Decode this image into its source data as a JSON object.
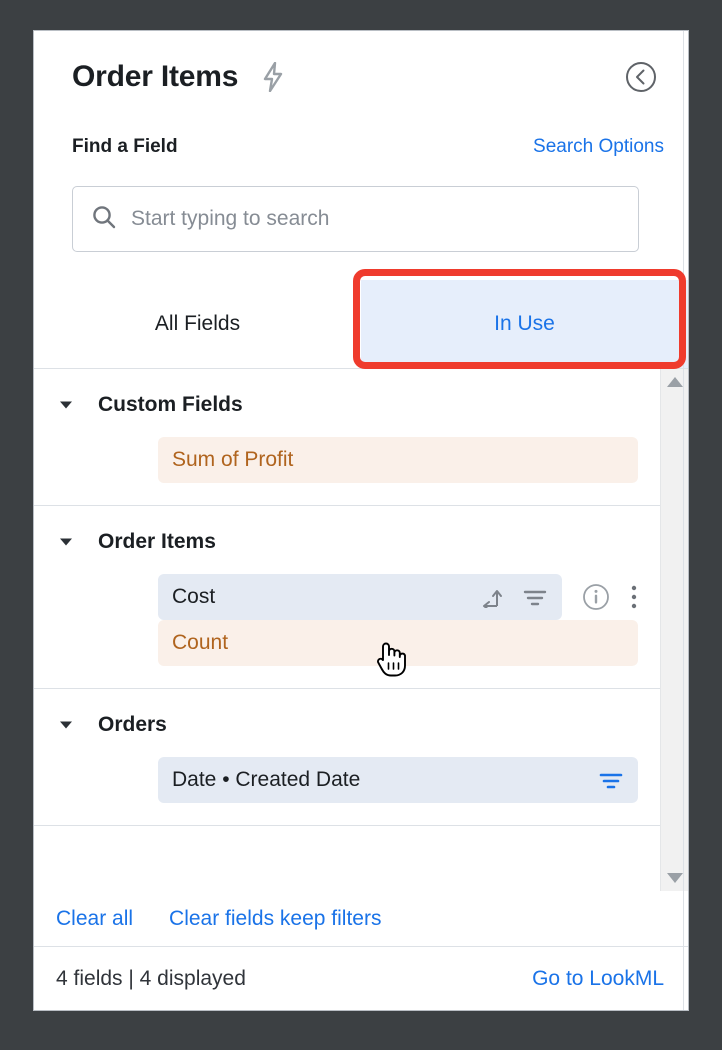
{
  "window": {
    "backdrop_color": "#3c4043",
    "panel_border_color": "#b9bec4"
  },
  "header": {
    "title": "Order Items",
    "bolt_icon": "lightning-bolt-icon",
    "collapse_icon": "chevron-left-circle-icon"
  },
  "find": {
    "label": "Find a Field",
    "search_options_label": "Search Options"
  },
  "search": {
    "icon": "search-icon",
    "value": "",
    "placeholder": "Start typing to search"
  },
  "tabs": [
    {
      "label": "All Fields",
      "active": false
    },
    {
      "label": "In Use",
      "active": true
    }
  ],
  "highlight": {
    "target": "In Use",
    "color": "#ef3b2d"
  },
  "sections": [
    {
      "title": "Custom Fields",
      "expanded": true,
      "fields": [
        {
          "label": "Sum of Profit",
          "kind": "measure",
          "icons": []
        }
      ]
    },
    {
      "title": "Order Items",
      "expanded": true,
      "fields": [
        {
          "label": "Cost",
          "kind": "dimension",
          "icons": [
            "pivot-icon",
            "filter-icon"
          ],
          "row_icons": [
            "info-icon",
            "overflow-menu-icon"
          ],
          "hovered": true
        },
        {
          "label": "Count",
          "kind": "measure",
          "icons": []
        }
      ]
    },
    {
      "title": "Orders",
      "expanded": true,
      "fields": [
        {
          "label": "Date • Created Date",
          "kind": "dimension",
          "icons": [
            "filter-icon-active"
          ]
        }
      ]
    }
  ],
  "clear_bar": {
    "clear_all_label": "Clear all",
    "clear_fields_label": "Clear fields keep filters"
  },
  "footer": {
    "count_text": "4 fields | 4 displayed",
    "lookml_label": "Go to LookML"
  },
  "scrollbar": {
    "up_icon": "scroll-up-arrow-icon",
    "down_icon": "scroll-down-arrow-icon"
  },
  "cursor": {
    "icon": "pointing-hand-cursor"
  },
  "colors": {
    "link_blue": "#1a73e8",
    "measure_bg": "#faf0e9",
    "measure_text": "#b0641e",
    "dimension_bg": "#e4eaf3",
    "active_tab_bg": "#e6eefb",
    "highlight_red": "#ef3b2d"
  }
}
